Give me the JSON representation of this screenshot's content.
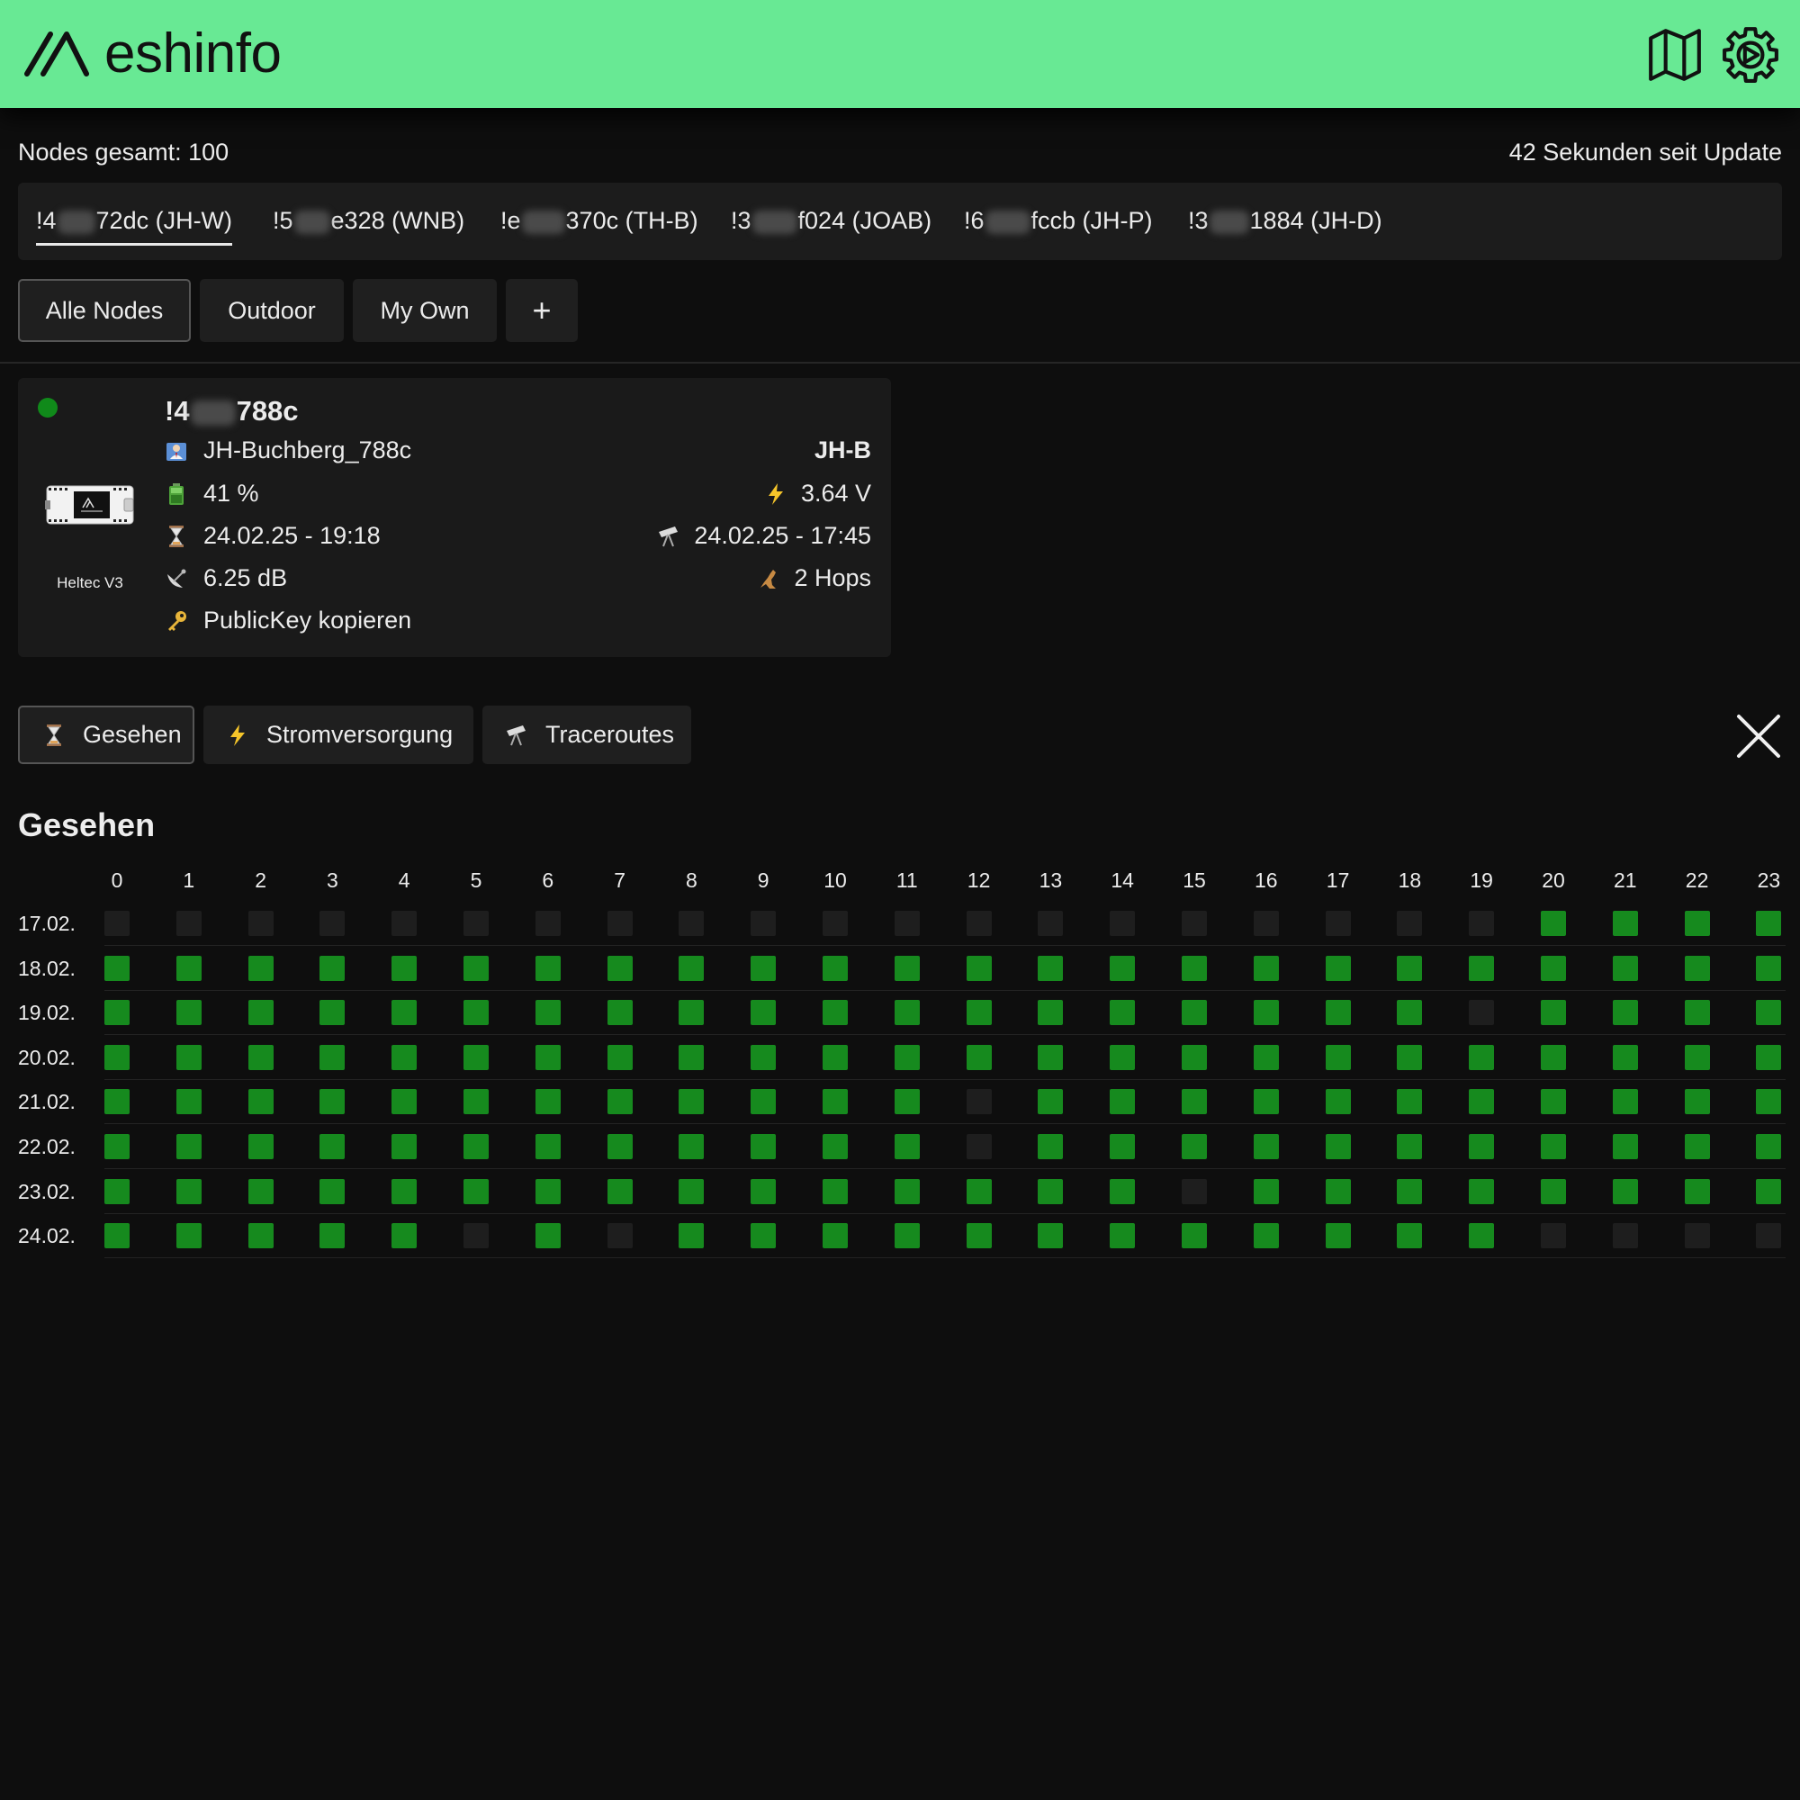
{
  "app": {
    "logo_text": "eshinfo",
    "logo_mark": "M",
    "map_button_icon": "map-icon",
    "settings_button_icon": "settings-gear-icon"
  },
  "stats": {
    "nodes_total": "Nodes gesamt: 100",
    "last_update": "42 Sekunden seit Update"
  },
  "favorites": [
    {
      "prefix": "!4",
      "suffix": "72dc (JH-W)",
      "active": true
    },
    {
      "prefix": "!5",
      "suffix": "e328 (WNB)",
      "active": false
    },
    {
      "prefix": "!e",
      "suffix": "370c (TH-B)",
      "active": false
    },
    {
      "prefix": "!3",
      "suffix": "f024 (JOAB)",
      "active": false
    },
    {
      "prefix": "!6",
      "suffix": "fccb (JH-P)",
      "active": false
    },
    {
      "prefix": "!3",
      "suffix": "1884 (JH-D)",
      "active": false
    }
  ],
  "groups": {
    "items": [
      {
        "label": "Alle Nodes",
        "active": true
      },
      {
        "label": "Outdoor",
        "active": false
      },
      {
        "label": "My Own",
        "active": false
      }
    ],
    "add_label": "+"
  },
  "node": {
    "id_prefix": "!4",
    "id_suffix": "788c",
    "long_name": "JH-Buchberg_788c",
    "short_name": "JH-B",
    "battery": "41 %",
    "voltage": "3.64 V",
    "last_seen": "24.02.25 - 19:18",
    "last_traceroute": "24.02.25 - 17:45",
    "snr": "6.25 dB",
    "hops": "2 Hops",
    "public_key_label": "PublicKey kopieren",
    "device": "Heltec V3",
    "online": true,
    "status_color": "#108a1a"
  },
  "detail_tabs": [
    {
      "label": "Gesehen",
      "icon": "hourglass-icon",
      "active": true
    },
    {
      "label": "Stromversorgung",
      "icon": "lightning-icon",
      "active": false
    },
    {
      "label": "Traceroutes",
      "icon": "telescope-icon",
      "active": false
    }
  ],
  "seen": {
    "title": "Gesehen",
    "hours": [
      "0",
      "1",
      "2",
      "3",
      "4",
      "5",
      "6",
      "7",
      "8",
      "9",
      "10",
      "11",
      "12",
      "13",
      "14",
      "15",
      "16",
      "17",
      "18",
      "19",
      "20",
      "21",
      "22",
      "23"
    ],
    "rows": [
      {
        "date": "17.02.",
        "seen": [
          0,
          0,
          0,
          0,
          0,
          0,
          0,
          0,
          0,
          0,
          0,
          0,
          0,
          0,
          0,
          0,
          0,
          0,
          0,
          0,
          1,
          1,
          1,
          1
        ]
      },
      {
        "date": "18.02.",
        "seen": [
          1,
          1,
          1,
          1,
          1,
          1,
          1,
          1,
          1,
          1,
          1,
          1,
          1,
          1,
          1,
          1,
          1,
          1,
          1,
          1,
          1,
          1,
          1,
          1
        ]
      },
      {
        "date": "19.02.",
        "seen": [
          1,
          1,
          1,
          1,
          1,
          1,
          1,
          1,
          1,
          1,
          1,
          1,
          1,
          1,
          1,
          1,
          1,
          1,
          1,
          0,
          1,
          1,
          1,
          1
        ]
      },
      {
        "date": "20.02.",
        "seen": [
          1,
          1,
          1,
          1,
          1,
          1,
          1,
          1,
          1,
          1,
          1,
          1,
          1,
          1,
          1,
          1,
          1,
          1,
          1,
          1,
          1,
          1,
          1,
          1
        ]
      },
      {
        "date": "21.02.",
        "seen": [
          1,
          1,
          1,
          1,
          1,
          1,
          1,
          1,
          1,
          1,
          1,
          1,
          0,
          1,
          1,
          1,
          1,
          1,
          1,
          1,
          1,
          1,
          1,
          1
        ]
      },
      {
        "date": "22.02.",
        "seen": [
          1,
          1,
          1,
          1,
          1,
          1,
          1,
          1,
          1,
          1,
          1,
          1,
          0,
          1,
          1,
          1,
          1,
          1,
          1,
          1,
          1,
          1,
          1,
          1
        ]
      },
      {
        "date": "23.02.",
        "seen": [
          1,
          1,
          1,
          1,
          1,
          1,
          1,
          1,
          1,
          1,
          1,
          1,
          1,
          1,
          1,
          0,
          1,
          1,
          1,
          1,
          1,
          1,
          1,
          1
        ]
      },
      {
        "date": "24.02.",
        "seen": [
          1,
          1,
          1,
          1,
          1,
          0,
          1,
          0,
          1,
          1,
          1,
          1,
          1,
          1,
          1,
          1,
          1,
          1,
          1,
          1,
          0,
          0,
          0,
          0
        ]
      }
    ],
    "on_color": "#168a1e",
    "off_color": "#1e1e1e"
  },
  "colors": {
    "header_bg": "#68e994",
    "page_bg": "#0e0e0e",
    "card_bg": "#1a1a1a"
  }
}
